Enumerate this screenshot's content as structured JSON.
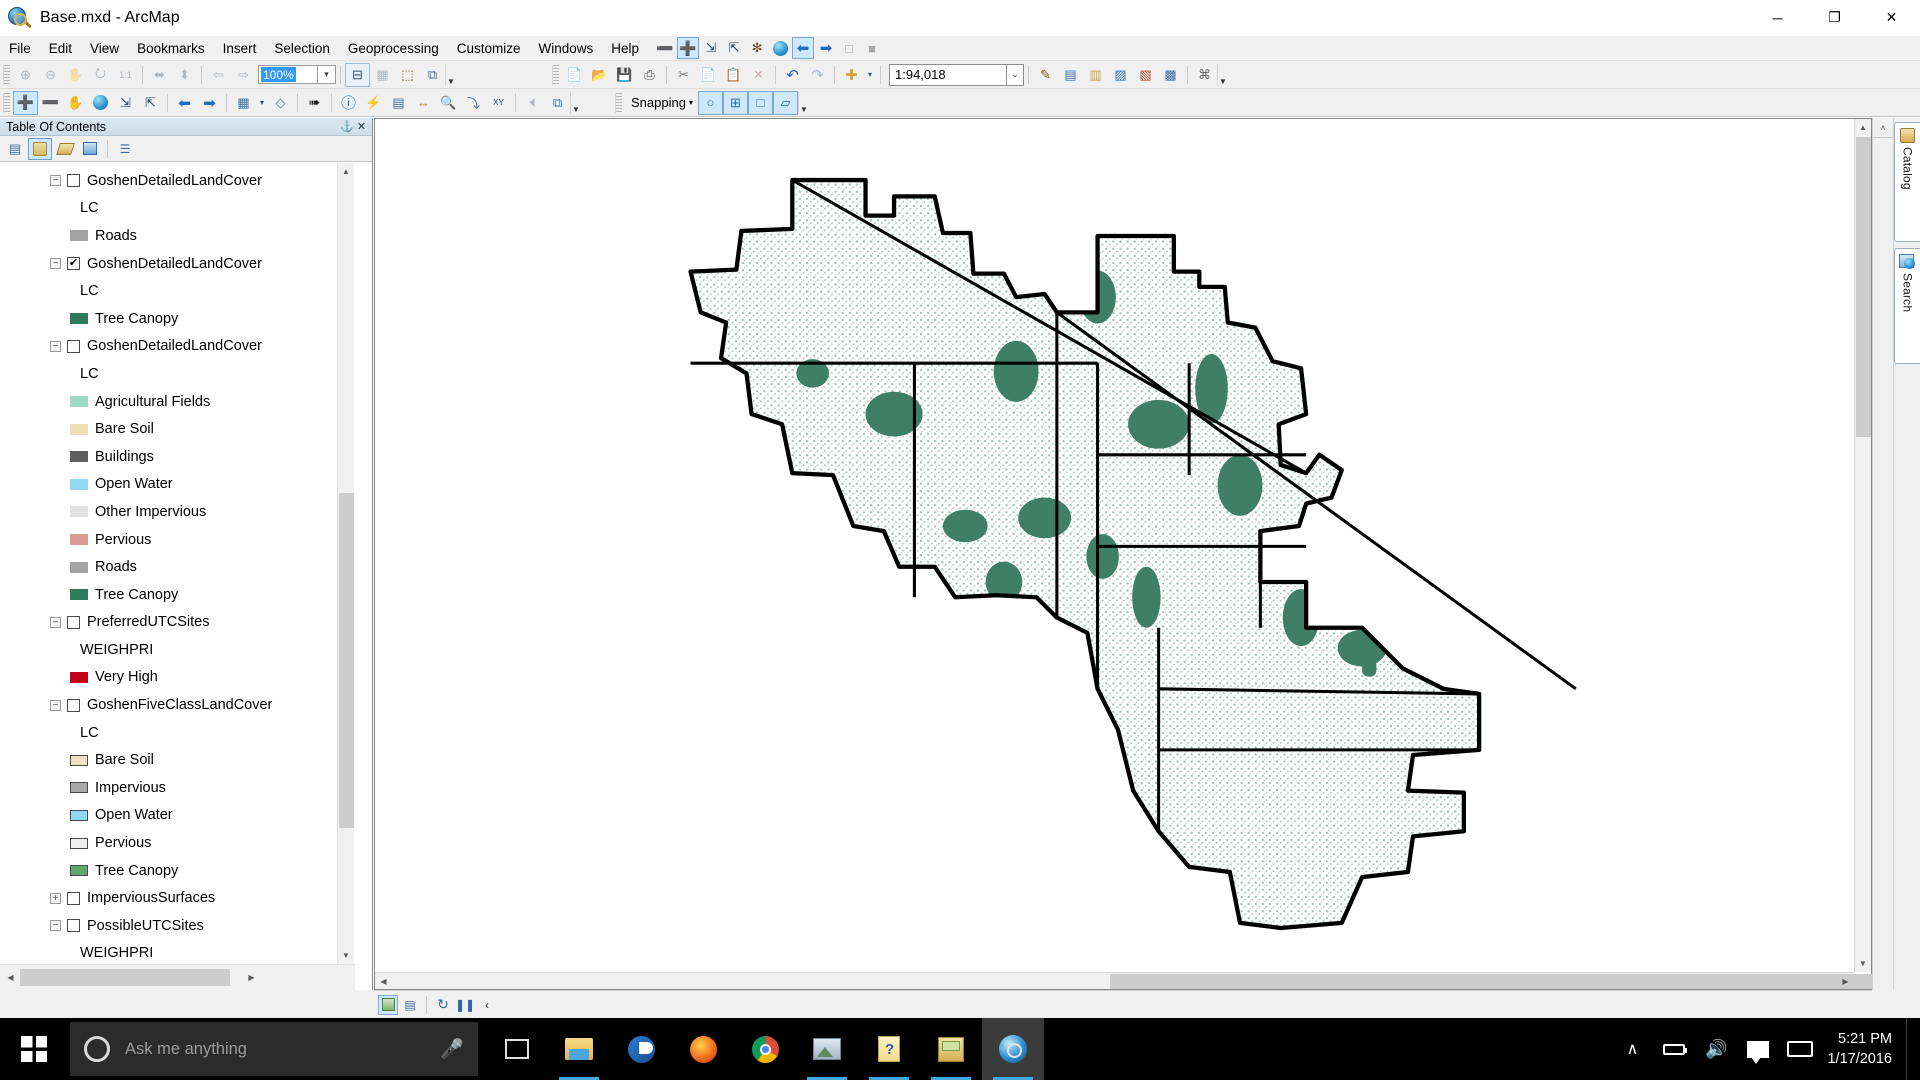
{
  "window": {
    "title": "Base.mxd - ArcMap",
    "app_icon": "arcmap-globe-icon",
    "minimize": "─",
    "maximize": "❐",
    "close": "✕"
  },
  "menu": {
    "items": [
      "File",
      "Edit",
      "View",
      "Bookmarks",
      "Insert",
      "Selection",
      "Geoprocessing",
      "Customize",
      "Windows",
      "Help"
    ],
    "tools": [
      {
        "name": "zoom-out-icon",
        "glyph": "⊖"
      },
      {
        "name": "zoom-in-icon",
        "glyph": "⊕",
        "active": true
      },
      {
        "name": "fixed-zoom-out-icon",
        "glyph": "⤡"
      },
      {
        "name": "fixed-zoom-in-icon",
        "glyph": "⤢"
      },
      {
        "name": "pan-zoom-icon",
        "glyph": "✥"
      },
      {
        "name": "full-extent-globe-icon",
        "glyph": "●"
      },
      {
        "name": "go-back-extent-icon",
        "glyph": "←",
        "active": true
      },
      {
        "name": "go-forward-extent-icon",
        "glyph": "→"
      },
      {
        "name": "page-icon",
        "glyph": "□"
      },
      {
        "name": "refresh-view-icon",
        "glyph": "■"
      }
    ]
  },
  "toolbar_draw": {
    "buttons": [
      {
        "name": "zoom-in-page-icon",
        "glyph": "⊕",
        "disabled": true
      },
      {
        "name": "zoom-out-page-icon",
        "glyph": "⊖",
        "disabled": true
      },
      {
        "name": "pan-page-icon",
        "glyph": "✋",
        "disabled": true
      },
      {
        "name": "full-page-extent-icon",
        "glyph": "⭮",
        "disabled": true
      },
      {
        "name": "one-to-one-icon",
        "glyph": "1:1",
        "disabled": true
      },
      {
        "name": "zoom-to-whole-page-icon",
        "glyph": "⬌",
        "disabled": true
      },
      {
        "name": "zoom-to-page-width-icon",
        "glyph": "⬍",
        "disabled": true
      },
      {
        "name": "go-back-page-icon",
        "glyph": "⇦",
        "disabled": true
      },
      {
        "name": "go-forward-page-icon",
        "glyph": "⇨",
        "disabled": true
      }
    ],
    "zoom_value": "100%",
    "after": [
      {
        "name": "toggle-draft-mode-icon",
        "glyph": "⊟"
      },
      {
        "name": "refresh-page-icon",
        "glyph": "▦",
        "disabled": true
      },
      {
        "name": "change-layout-icon",
        "glyph": "⬚"
      },
      {
        "name": "data-driven-pages-icon",
        "glyph": "⧉"
      }
    ]
  },
  "toolbar_standard": {
    "buttons": [
      {
        "name": "new-document-icon",
        "glyph": "⬜"
      },
      {
        "name": "open-document-icon",
        "glyph": "📂"
      },
      {
        "name": "save-document-icon",
        "glyph": "💾"
      },
      {
        "name": "print-icon",
        "glyph": "⎙"
      },
      {
        "name": "cut-icon",
        "glyph": "✂"
      },
      {
        "name": "copy-icon",
        "glyph": "⧉"
      },
      {
        "name": "paste-icon",
        "glyph": "📋"
      },
      {
        "name": "delete-icon",
        "glyph": "✕",
        "disabled": true
      },
      {
        "name": "undo-icon",
        "glyph": "↶"
      },
      {
        "name": "redo-icon",
        "glyph": "↷",
        "disabled": true
      },
      {
        "name": "add-data-icon",
        "glyph": "⬧"
      }
    ],
    "scale": "1:94,018",
    "scale_caret": "⌄",
    "trailing": [
      {
        "name": "editor-toolbar-icon",
        "glyph": "✎"
      },
      {
        "name": "table-of-contents-icon",
        "glyph": "▤"
      },
      {
        "name": "catalog-window-icon",
        "glyph": "▥"
      },
      {
        "name": "search-window-icon",
        "glyph": "▨"
      },
      {
        "name": "arctoolbox-window-icon",
        "glyph": "▧"
      },
      {
        "name": "python-window-icon",
        "glyph": "▩"
      },
      {
        "name": "modelbuilder-icon",
        "glyph": "⌘"
      }
    ]
  },
  "toolbar_tools": {
    "buttons": [
      {
        "name": "zoom-in-icon",
        "glyph": "⊕",
        "active": true
      },
      {
        "name": "zoom-out-icon",
        "glyph": "⊖"
      },
      {
        "name": "pan-icon",
        "glyph": "✋"
      },
      {
        "name": "full-extent-icon",
        "glyph": "⬤"
      },
      {
        "name": "fixed-zoom-in-icon",
        "glyph": "⤡"
      },
      {
        "name": "fixed-zoom-out-icon",
        "glyph": "⤢"
      },
      {
        "name": "go-back-extent-icon",
        "glyph": "⬅"
      },
      {
        "name": "go-forward-extent-icon",
        "glyph": "➡"
      },
      {
        "name": "select-features-icon",
        "glyph": "⬚"
      },
      {
        "name": "select-by-polygon-icon",
        "glyph": "◇"
      },
      {
        "name": "select-elements-icon",
        "glyph": "↖"
      },
      {
        "name": "identify-icon",
        "glyph": "ⓘ"
      },
      {
        "name": "hyperlink-icon",
        "glyph": "⚡"
      },
      {
        "name": "html-popup-icon",
        "glyph": "▤"
      },
      {
        "name": "measure-icon",
        "glyph": "↔"
      },
      {
        "name": "find-icon",
        "glyph": "🔍"
      },
      {
        "name": "find-route-icon",
        "glyph": "⤵"
      },
      {
        "name": "go-to-xy-icon",
        "glyph": "XY"
      },
      {
        "name": "time-slider-icon",
        "glyph": "◴",
        "disabled": true
      },
      {
        "name": "create-viewer-window-icon",
        "glyph": "⧉"
      }
    ],
    "snapping_label": "Snapping",
    "snapping_caret": "▾",
    "snapping_buttons": [
      {
        "name": "point-snapping-icon",
        "glyph": "○",
        "active": true
      },
      {
        "name": "end-snapping-icon",
        "glyph": "⊞",
        "active": true
      },
      {
        "name": "vertex-snapping-icon",
        "glyph": "□",
        "active": true
      },
      {
        "name": "edge-snapping-icon",
        "glyph": "▱",
        "active": true
      }
    ]
  },
  "toc": {
    "title": "Table Of Contents",
    "pin_glyph": "⚓",
    "close_glyph": "✕",
    "tools": [
      {
        "name": "list-by-drawing-order-icon",
        "glyph": "☲"
      },
      {
        "name": "list-by-source-icon",
        "glyph": "◓",
        "active": true
      },
      {
        "name": "list-by-visibility-icon",
        "glyph": "◈"
      },
      {
        "name": "list-by-selection-icon",
        "glyph": "◰"
      },
      {
        "name": "options-icon",
        "glyph": "☷"
      }
    ],
    "rows": [
      {
        "kind": "layer",
        "label": "GoshenDetailedLandCover",
        "expander": "−",
        "checked": false
      },
      {
        "kind": "field",
        "label": "LC"
      },
      {
        "kind": "symbol",
        "label": "Roads",
        "color": "#a3a3a3",
        "outline": false
      },
      {
        "kind": "layer",
        "label": "GoshenDetailedLandCover",
        "expander": "−",
        "checked": true
      },
      {
        "kind": "field",
        "label": "LC"
      },
      {
        "kind": "symbol",
        "label": "Tree Canopy",
        "color": "#2f7a5a",
        "outline": false
      },
      {
        "kind": "layer",
        "label": "GoshenDetailedLandCover",
        "expander": "−",
        "checked": false
      },
      {
        "kind": "field",
        "label": "LC"
      },
      {
        "kind": "symbol",
        "label": "Agricultural Fields",
        "color": "#9fd9c2",
        "outline": false
      },
      {
        "kind": "symbol",
        "label": "Bare Soil",
        "color": "#ecdfb6",
        "outline": false
      },
      {
        "kind": "symbol",
        "label": "Buildings",
        "color": "#5e5e5e",
        "outline": false
      },
      {
        "kind": "symbol",
        "label": "Open Water",
        "color": "#90daf2",
        "outline": false
      },
      {
        "kind": "symbol",
        "label": "Other Impervious",
        "color": "#e2e2e2",
        "outline": false
      },
      {
        "kind": "symbol",
        "label": "Pervious",
        "color": "#d99a96",
        "outline": false
      },
      {
        "kind": "symbol",
        "label": "Roads",
        "color": "#a3a3a3",
        "outline": false
      },
      {
        "kind": "symbol",
        "label": "Tree Canopy",
        "color": "#2f7a5a",
        "outline": false
      },
      {
        "kind": "layer",
        "label": "PreferredUTCSites",
        "expander": "−",
        "checked": false
      },
      {
        "kind": "field",
        "label": "WEIGHPRI"
      },
      {
        "kind": "symbol",
        "label": "Very High",
        "color": "#c00016",
        "outline": false
      },
      {
        "kind": "layer",
        "label": "GoshenFiveClassLandCover",
        "expander": "−",
        "checked": false
      },
      {
        "kind": "field",
        "label": "LC"
      },
      {
        "kind": "symbol",
        "label": "Bare Soil",
        "color": "#ece2c0",
        "outline": true
      },
      {
        "kind": "symbol",
        "label": "Impervious",
        "color": "#a8a8a8",
        "outline": true
      },
      {
        "kind": "symbol",
        "label": "Open Water",
        "color": "#8fd8f3",
        "outline": true
      },
      {
        "kind": "symbol",
        "label": "Pervious",
        "color": "#eeeeee",
        "outline": true
      },
      {
        "kind": "symbol",
        "label": "Tree Canopy",
        "color": "#5fa86c",
        "outline": true
      },
      {
        "kind": "layer",
        "label": "ImperviousSurfaces",
        "expander": "+",
        "checked": false
      },
      {
        "kind": "layer",
        "label": "PossibleUTCSites",
        "expander": "−",
        "checked": false
      },
      {
        "kind": "field",
        "label": "WEIGHPRI"
      }
    ],
    "scroll_up": "▲",
    "scroll_down": "▼",
    "scroll_left": "◀",
    "scroll_right": "▶"
  },
  "map_status": {
    "buttons": [
      {
        "name": "data-view-icon",
        "glyph": "▣",
        "active": true
      },
      {
        "name": "layout-view-icon",
        "glyph": "▤"
      },
      {
        "name": "refresh-view-icon",
        "glyph": "↻"
      },
      {
        "name": "pause-drawing-icon",
        "glyph": "⏸"
      },
      {
        "name": "collapse-status-icon",
        "glyph": "‹"
      }
    ]
  },
  "right_dock": {
    "collapse_glyph": "˄",
    "tabs": [
      {
        "label": "Catalog",
        "icon": "catalog-icon"
      },
      {
        "label": "Search",
        "icon": "search-icon"
      }
    ]
  },
  "map": {
    "boundary_color": "#000000",
    "canopy_color": "#4f8f76",
    "background": "#ffffff",
    "scroll_up": "▲",
    "scroll_down": "▼",
    "scroll_left": "◀",
    "scroll_right": "▶"
  },
  "taskbar": {
    "start_icon": "windows-start-icon",
    "search_placeholder": "Ask me anything",
    "mic_icon": "microphone-icon",
    "task_view_icon": "task-view-icon",
    "apps": [
      {
        "name": "file-explorer-icon",
        "open": true
      },
      {
        "name": "edge-browser-icon",
        "open": false
      },
      {
        "name": "firefox-browser-icon",
        "open": false
      },
      {
        "name": "chrome-browser-icon",
        "open": false
      },
      {
        "name": "photos-icon",
        "open": true
      },
      {
        "name": "help-icon",
        "open": true
      },
      {
        "name": "arccatalog-icon",
        "open": true
      },
      {
        "name": "arcmap-icon",
        "open": true,
        "active": true
      }
    ],
    "tray": [
      {
        "name": "show-hidden-icons-icon",
        "glyph": "∧"
      },
      {
        "name": "battery-icon",
        "glyph": "🔌"
      },
      {
        "name": "volume-icon",
        "glyph": "🔊"
      },
      {
        "name": "action-center-icon",
        "glyph": "💬"
      },
      {
        "name": "keyboard-icon",
        "glyph": "⌨"
      }
    ],
    "time": "5:21 PM",
    "date": "1/17/2016"
  }
}
